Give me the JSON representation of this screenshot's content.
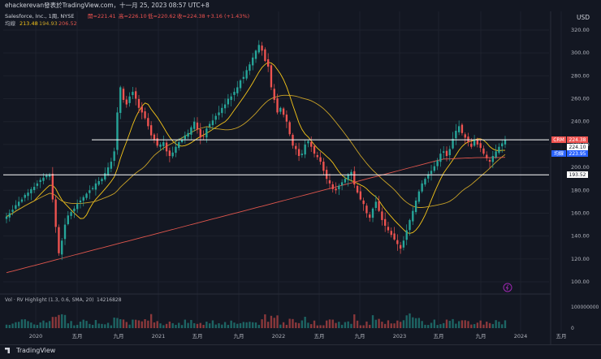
{
  "header": {
    "publisher_line": "ehackerevan發表於TradingView.com，十一月 25, 2023 08:57 UTC+8",
    "currency": "USD",
    "symbol_line": {
      "name": "Salesforce, Inc., 1周, NYSE",
      "open": "開=221.41",
      "high": "高=226.10",
      "low": "低=220.62",
      "close": "收=224.38",
      "change": "+3.16 (+1.43%)"
    },
    "ma_line": {
      "label": "均線",
      "ma1": "213.48",
      "ma2": "194.93",
      "ma3": "206.52"
    }
  },
  "price_tags": {
    "crm_label": "CRM",
    "crm_value": "224.38",
    "line_value": "224.10",
    "ma_tag_label": "均線",
    "ma_tag_value": "223.95",
    "support_value": "193.52"
  },
  "volume_legend": {
    "label": "Vol · RV Highlight (1.3, 0.6, SMA, 20)",
    "value": "14216828"
  },
  "volume_axis": {
    "top": "100000000",
    "bottom": "0"
  },
  "footer": {
    "brand": "TradingView"
  },
  "colors": {
    "up": "#26a69a",
    "down": "#ef5350",
    "ma_fast": "#f5c518",
    "ma_mid": "#c9a227",
    "ma_slow": "#e0564d",
    "hline": "#ffffff",
    "background": "#131722",
    "crm_tag": "#ef5350",
    "ma_tag": "#2962ff"
  },
  "chart_data": {
    "type": "candlestick",
    "y_axis": {
      "ticks": [
        "320.00",
        "300.00",
        "280.00",
        "260.00",
        "240.00",
        "220.00",
        "200.00",
        "180.00",
        "160.00",
        "140.00",
        "120.00",
        "100.00"
      ],
      "range": [
        93,
        328
      ]
    },
    "x_axis": {
      "ticks": [
        "2020",
        "五月",
        "九月",
        "2021",
        "五月",
        "九月",
        "2022",
        "五月",
        "九月",
        "2023",
        "五月",
        "九月",
        "2024",
        "五月"
      ]
    },
    "horizontal_lines": [
      224.1,
      193.52
    ],
    "weekly_closes": [
      157,
      160,
      163,
      167,
      170,
      172,
      176,
      178,
      181,
      183,
      186,
      189,
      191,
      193,
      194,
      172,
      148,
      125,
      136,
      150,
      158,
      161,
      164,
      168,
      171,
      174,
      177,
      180,
      182,
      186,
      188,
      190,
      195,
      200,
      205,
      214,
      248,
      270,
      259,
      255,
      262,
      266,
      260,
      252,
      248,
      243,
      236,
      228,
      224,
      219,
      220,
      222,
      214,
      210,
      213,
      218,
      222,
      224,
      228,
      230,
      235,
      240,
      233,
      226,
      227,
      234,
      238,
      241,
      245,
      248,
      252,
      255,
      260,
      262,
      266,
      270,
      276,
      279,
      285,
      290,
      296,
      302,
      307,
      302,
      293,
      288,
      270,
      259,
      248,
      252,
      246,
      240,
      229,
      219,
      216,
      210,
      212,
      220,
      223,
      218,
      212,
      209,
      205,
      197,
      190,
      186,
      181,
      180,
      184,
      187,
      190,
      194,
      196,
      185,
      178,
      172,
      168,
      160,
      156,
      164,
      170,
      162,
      154,
      149,
      145,
      141,
      137,
      133,
      129,
      136,
      145,
      154,
      162,
      171,
      179,
      186,
      190,
      194,
      197,
      201,
      206,
      212,
      214,
      210,
      216,
      225,
      232,
      236,
      230,
      226,
      222,
      218,
      224,
      220,
      217,
      212,
      208,
      205,
      210,
      214,
      218,
      221,
      224
    ],
    "volume_max": 100000000,
    "volume_last": 14216828
  }
}
